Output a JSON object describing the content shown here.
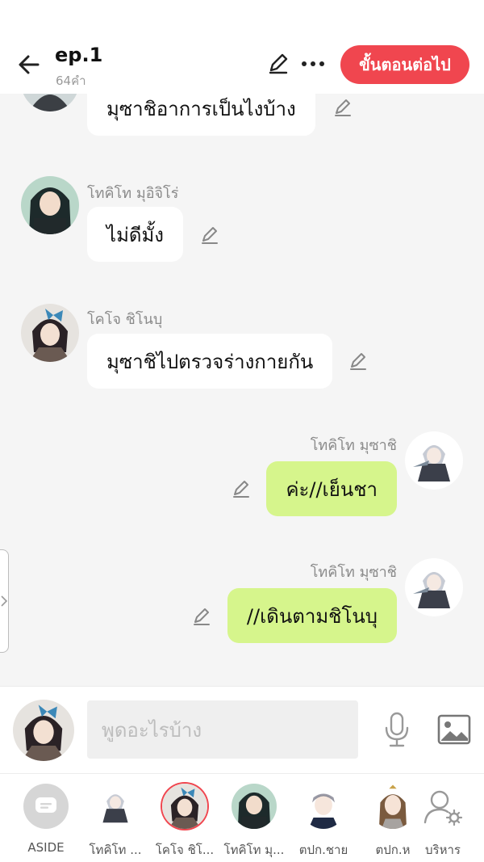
{
  "header": {
    "title": "ep.1",
    "word_count": "64คำ",
    "next_label": "ขั้นตอนต่อไป"
  },
  "messages": [
    {
      "side": "left",
      "name": "",
      "text": "มุซาชิอาการเป็นไงบ้าง",
      "avatar": "green-haired-character"
    },
    {
      "side": "left",
      "name": "โทคิโท มุอิจิโร่",
      "text": "ไม่ดีมั้ง",
      "avatar": "green-haired-character"
    },
    {
      "side": "left",
      "name": "โคโจ ชิโนบุ",
      "text": "มุซาชิไปตรวจร่างกายกัน",
      "avatar": "butterfly-character"
    },
    {
      "side": "right",
      "name": "โทคิโท มุซาชิ",
      "text": "ค่ะ//เย็นชา",
      "avatar": "silver-haired-character"
    },
    {
      "side": "right",
      "name": "โทคิโท มุซาชิ",
      "text": "//เดินตามชิโนบุ",
      "avatar": "silver-haired-character"
    }
  ],
  "composer": {
    "placeholder": "พูดอะไรบ้าง"
  },
  "characters": [
    {
      "label": "ASIDE",
      "kind": "aside"
    },
    {
      "label": "โทคิโท ...",
      "kind": "silver"
    },
    {
      "label": "โคโจ ชิโ...",
      "kind": "butterfly",
      "selected": true
    },
    {
      "label": "โทคิโท มุ...",
      "kind": "green"
    },
    {
      "label": "ตปก.ชาย",
      "kind": "boy"
    },
    {
      "label": "ตปก.ห",
      "kind": "girl"
    },
    {
      "label": "บริหาร",
      "kind": "manage"
    }
  ],
  "colors": {
    "accent": "#f0464f",
    "my_bubble": "#d6f58c",
    "their_bubble": "#ffffff"
  }
}
